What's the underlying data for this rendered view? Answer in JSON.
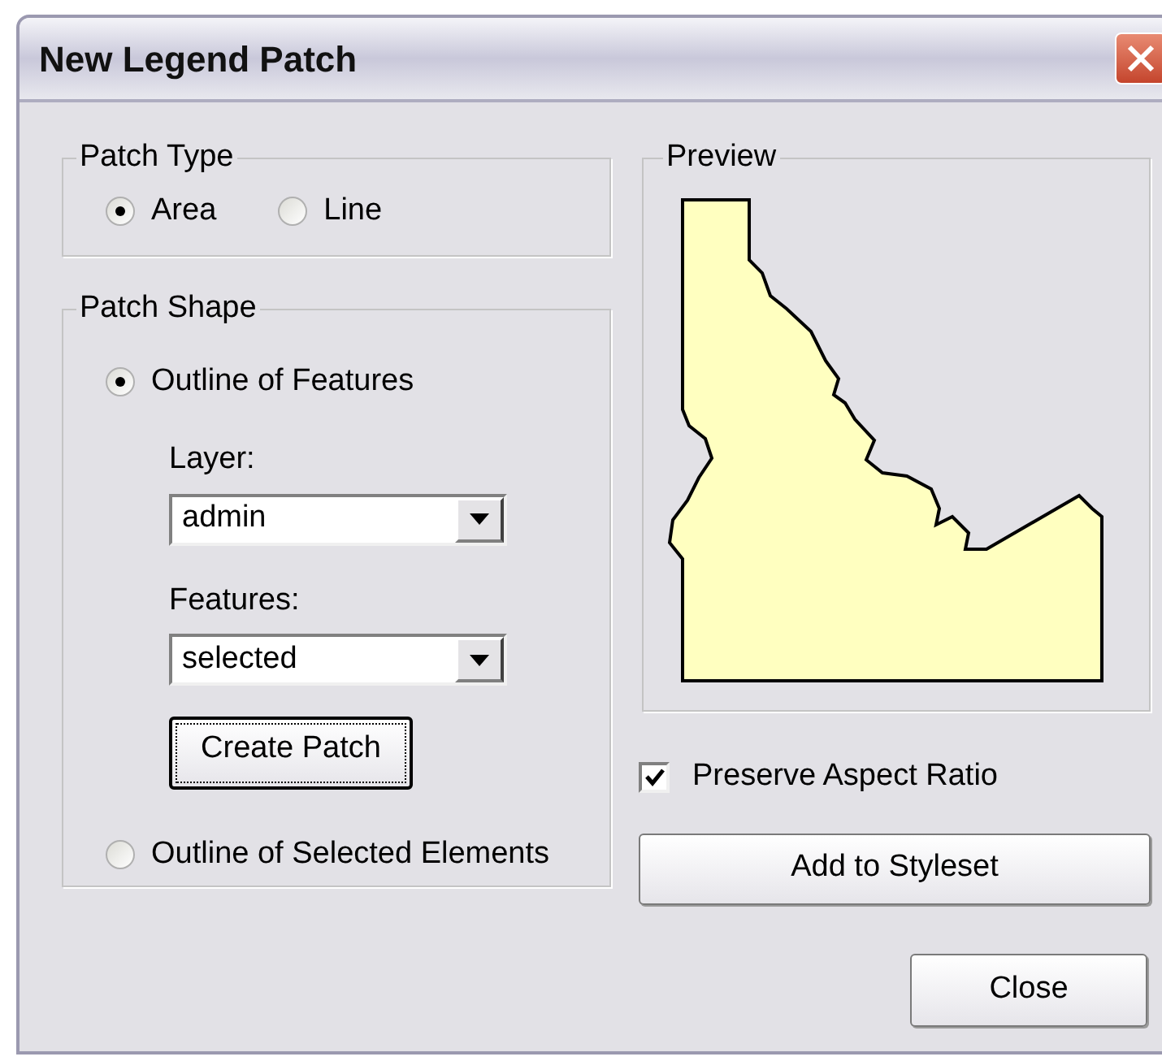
{
  "window": {
    "title": "New Legend Patch"
  },
  "patch_type": {
    "label": "Patch Type",
    "options": [
      {
        "label": "Area",
        "selected": true
      },
      {
        "label": "Line",
        "selected": false
      }
    ]
  },
  "patch_shape": {
    "label": "Patch Shape",
    "options": [
      {
        "label": "Outline of Features",
        "selected": true
      },
      {
        "label": "Outline of Selected Elements",
        "selected": false
      }
    ],
    "layer": {
      "label": "Layer:",
      "value": "admin"
    },
    "features": {
      "label": "Features:",
      "value": "selected"
    },
    "create_button": {
      "label": "Create Patch",
      "focused": true
    }
  },
  "preview": {
    "label": "Preview"
  },
  "preserve_aspect_ratio": {
    "label": "Preserve Aspect Ratio",
    "checked": true
  },
  "buttons": [
    {
      "label": "Add to Styleset"
    },
    {
      "label": "Close"
    }
  ]
}
